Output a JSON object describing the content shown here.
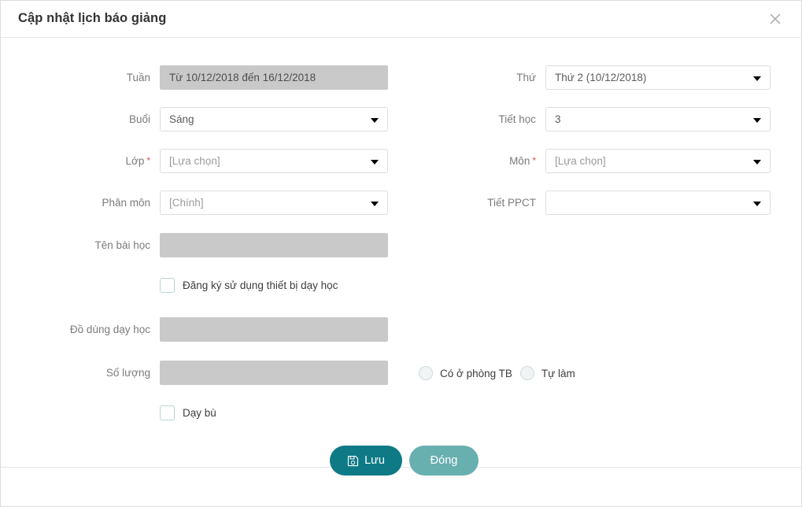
{
  "dialog": {
    "title": "Cập nhật lịch báo giảng",
    "close_icon": "close-icon"
  },
  "form": {
    "left": [
      {
        "label": "Tuần",
        "required": false,
        "type": "readonly",
        "value": "Từ 10/12/2018 đến 16/12/2018"
      },
      {
        "label": "Buổi",
        "required": false,
        "type": "select",
        "value": "Sáng"
      },
      {
        "label": "Lớp",
        "required": true,
        "type": "select",
        "value": "[Lựa chọn]"
      },
      {
        "label": "Phân môn",
        "required": false,
        "type": "select",
        "value": "[Chính]"
      },
      {
        "label": "Tên bài học",
        "required": false,
        "type": "textfield",
        "value": ""
      },
      {
        "label": "Đồ dùng dạy học",
        "required": false,
        "type": "textfield",
        "value": ""
      },
      {
        "label": "Số lượng",
        "required": false,
        "type": "textfield",
        "value": ""
      }
    ],
    "right": [
      {
        "label": "Thứ",
        "required": false,
        "type": "select",
        "value": "Thứ 2 (10/12/2018)"
      },
      {
        "label": "Tiết học",
        "required": false,
        "type": "select",
        "value": "3"
      },
      {
        "label": "Môn",
        "required": true,
        "type": "select",
        "value": "[Lựa chọn]"
      },
      {
        "label": "Tiết PPCT",
        "required": false,
        "type": "select",
        "value": ""
      }
    ],
    "checkbox_device": {
      "label": "Đăng ký sử dụng thiết bị dạy học",
      "checked": false
    },
    "checkbox_makeup": {
      "label": "Dạy bù",
      "checked": false
    },
    "radios": [
      {
        "label": "Có ở phòng TB",
        "selected": false
      },
      {
        "label": "Tự làm",
        "selected": false
      }
    ]
  },
  "footer": {
    "save_label": "Lưu",
    "save_icon": "save-floppy-icon",
    "close_label": "Đóng"
  },
  "colors": {
    "save_bg": "#0e7a86",
    "close_bg": "#68afb0",
    "required_mark": "#e8503a",
    "readonly_bg": "#c9c9c9"
  }
}
